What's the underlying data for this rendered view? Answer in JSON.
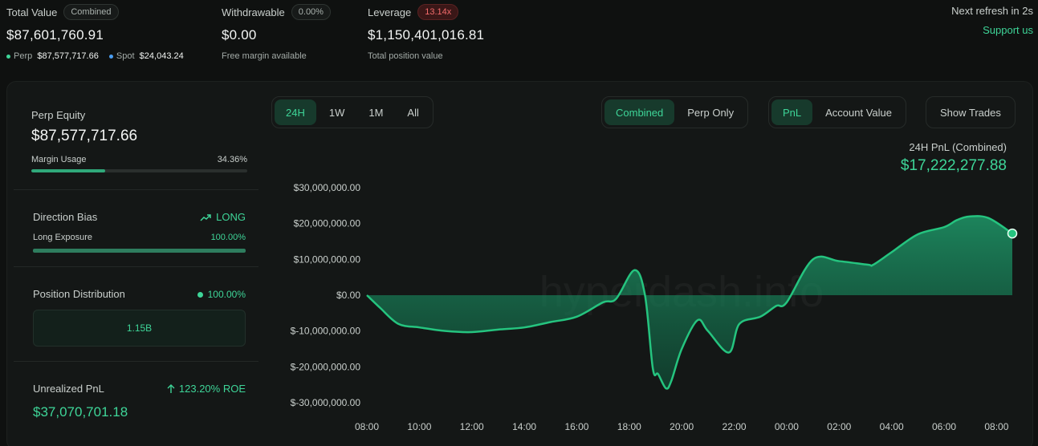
{
  "stats": {
    "total_value": {
      "label": "Total Value",
      "pill": "Combined",
      "value": "$87,601,760.91"
    },
    "perp": {
      "label": "Perp",
      "value": "$87,577,717.66"
    },
    "spot": {
      "label": "Spot",
      "value": "$24,043.24"
    },
    "withdrawable": {
      "label": "Withdrawable",
      "pill": "0.00%",
      "value": "$0.00",
      "sub": "Free margin available"
    },
    "leverage": {
      "label": "Leverage",
      "pill": "13.14x",
      "value": "$1,150,401,016.81",
      "sub": "Total position value"
    },
    "refresh": "Next refresh in 2s",
    "support": "Support us"
  },
  "left": {
    "perp_equity": {
      "label": "Perp Equity",
      "value": "$87,577,717.66",
      "margin_label": "Margin Usage",
      "margin_value": "34.36%",
      "margin_pct": 34.36
    },
    "direction": {
      "label": "Direction Bias",
      "bias": "LONG",
      "exposure_label": "Long Exposure",
      "exposure_value": "100.00%",
      "exposure_pct": 100
    },
    "distribution": {
      "label": "Position Distribution",
      "value": "100.00%",
      "box": "1.15B"
    },
    "unrealized": {
      "label": "Unrealized PnL",
      "roe": "123.20% ROE",
      "value": "$37,070,701.18"
    }
  },
  "controls": {
    "range": [
      "24H",
      "1W",
      "1M",
      "All"
    ],
    "range_active": 0,
    "mode": [
      "Combined",
      "Perp Only"
    ],
    "mode_active": 0,
    "metric": [
      "PnL",
      "Account Value"
    ],
    "metric_active": 0,
    "show_trades": "Show Trades"
  },
  "chart_header": {
    "title": "24H PnL (Combined)",
    "value": "$17,222,277.88"
  },
  "chart_data": {
    "type": "area",
    "title": "24H PnL (Combined)",
    "watermark": "hyperdash.info",
    "ylim": [
      -30000000,
      30000000
    ],
    "y_ticks": [
      30000000,
      20000000,
      10000000,
      0,
      -10000000,
      -20000000,
      -30000000
    ],
    "y_tick_labels": [
      "$30,000,000.00",
      "$20,000,000.00",
      "$10,000,000.00",
      "$0.00",
      "$-10,000,000.00",
      "$-20,000,000.00",
      "$-30,000,000.00"
    ],
    "x_ticks": [
      0,
      2,
      4,
      6,
      8,
      10,
      12,
      14,
      16,
      18,
      20,
      22,
      24
    ],
    "x_tick_labels": [
      "08:00",
      "10:00",
      "12:00",
      "14:00",
      "16:00",
      "18:00",
      "20:00",
      "22:00",
      "00:00",
      "02:00",
      "04:00",
      "06:00",
      "08:00"
    ],
    "x_unit": "hours since 08:00",
    "x": [
      0,
      0.5,
      1.2,
      2,
      3,
      4,
      5,
      6,
      7,
      8,
      9,
      9.5,
      10.2,
      10.6,
      10.9,
      11.1,
      11.4,
      11.6,
      12,
      12.6,
      13,
      13.8,
      14.2,
      15,
      15.6,
      16,
      17,
      18,
      19.1,
      19.3,
      20,
      21,
      22,
      22.5,
      23,
      23.7,
      24.6
    ],
    "values": [
      0,
      -3500000,
      -8000000,
      -9000000,
      -10000000,
      -10300000,
      -9600000,
      -9000000,
      -7500000,
      -6000000,
      -2000000,
      -1000000,
      7000000,
      0,
      -20500000,
      -22000000,
      -26000000,
      -24000000,
      -15000000,
      -7000000,
      -10000000,
      -16000000,
      -8000000,
      -6000000,
      -3000000,
      -2000000,
      10000000,
      9500000,
      8500000,
      8500000,
      12000000,
      17000000,
      19000000,
      21000000,
      22000000,
      21500000,
      17222277
    ]
  }
}
